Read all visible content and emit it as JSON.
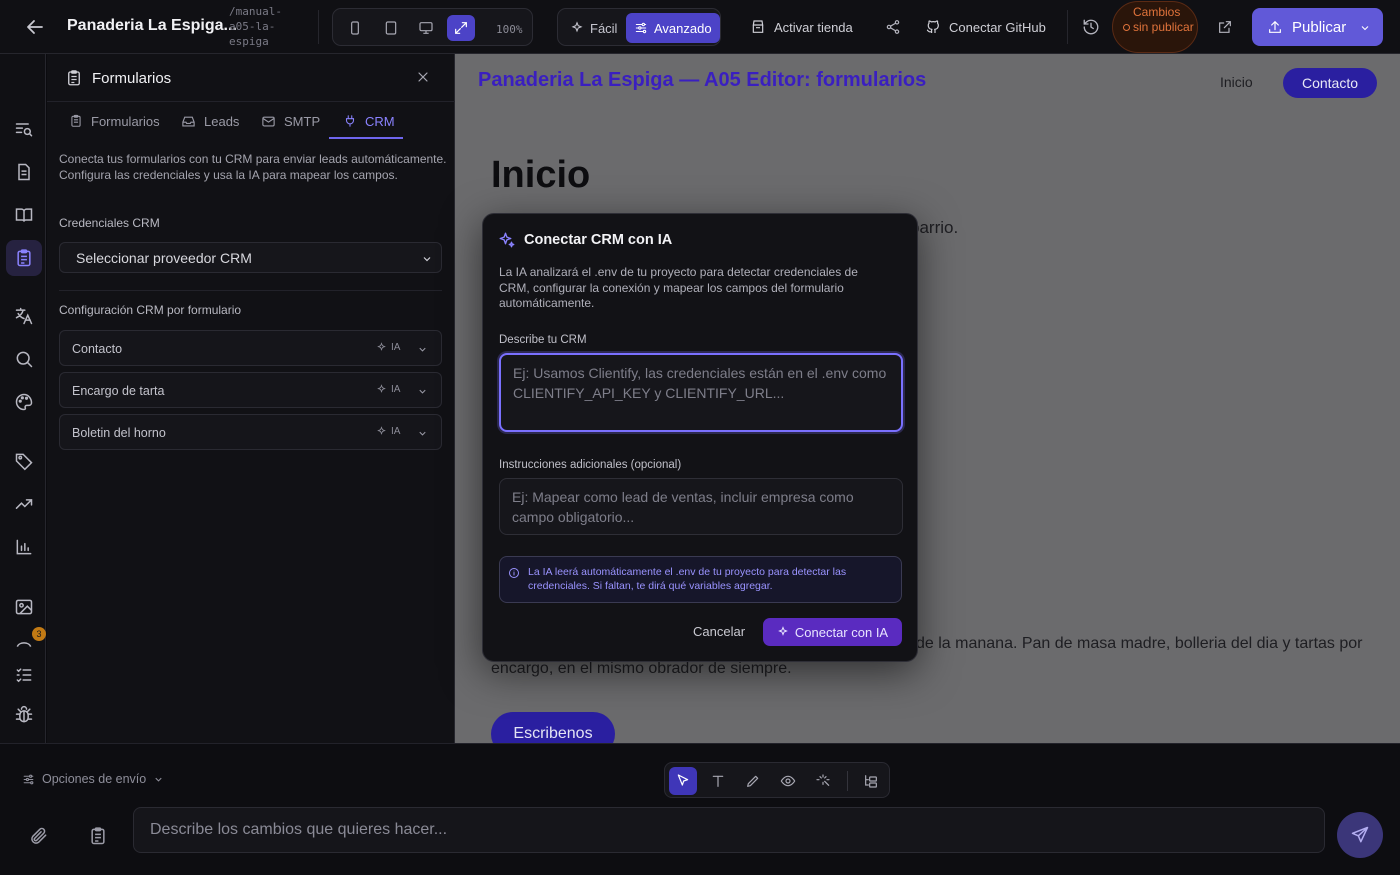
{
  "topbar": {
    "project_title": "Panaderia La Espiga...",
    "project_slug": "/manual-a05-la-espiga",
    "zoom": "100%",
    "mode_easy": "Fácil",
    "mode_advanced": "Avanzado",
    "activate_store": "Activar tienda",
    "connect_github": "Conectar GitHub",
    "unpublished": "Cambios sin publicar",
    "publish": "Publicar"
  },
  "rail": {
    "badge_count": "3"
  },
  "panel": {
    "title": "Formularios",
    "tabs": [
      {
        "label": "Formularios",
        "icon": "clipboard-icon"
      },
      {
        "label": "Leads",
        "icon": "inbox-icon"
      },
      {
        "label": "SMTP",
        "icon": "mail-icon"
      },
      {
        "label": "CRM",
        "icon": "plug-icon"
      }
    ],
    "description": "Conecta tus formularios con tu CRM para enviar leads automáticamente. Configura las credenciales y usa la IA para mapear los campos.",
    "credentials_title": "Credenciales CRM",
    "provider_select": "Seleccionar proveedor CRM",
    "per_form_title": "Configuración CRM por formulario",
    "forms": [
      {
        "name": "Contacto",
        "ia": "IA"
      },
      {
        "name": "Encargo de tarta",
        "ia": "IA"
      },
      {
        "name": "Boletin del horno",
        "ia": "IA"
      }
    ]
  },
  "preview": {
    "site_title": "Panaderia La Espiga — A05 Editor: formularios",
    "nav_home": "Inicio",
    "nav_contact": "Contacto",
    "hero_title": "Inicio",
    "hero_sub_visible": "barrio.",
    "body_visible_right": "de la manana. Pan de masa madre, bolleria del dia y tartas por",
    "body_line2": "encargo, en el mismo obrador de siempre.",
    "cta": "Escribenos"
  },
  "modal": {
    "title": "Conectar CRM con IA",
    "description": "La IA analizará el .env de tu proyecto para detectar credenciales de CRM, configurar la conexión y mapear los campos del formulario automáticamente.",
    "describe_label": "Describe tu CRM",
    "describe_placeholder": "Ej: Usamos Clientify, las credenciales están en el .env como CLIENTIFY_API_KEY y CLIENTIFY_URL...",
    "extra_label": "Instrucciones adicionales (opcional)",
    "extra_placeholder": "Ej: Mapear como lead de ventas, incluir empresa como campo obligatorio...",
    "info": "La IA leerá automáticamente el .env de tu proyecto para detectar las credenciales. Si faltan, te dirá qué variables agregar.",
    "cancel": "Cancelar",
    "connect": "Conectar con IA"
  },
  "bottom": {
    "send_options": "Opciones de envío",
    "prompt_placeholder": "Describe los cambios que quieres hacer..."
  },
  "colors": {
    "accent": "#6159d8",
    "accent_active": "#4c43c7",
    "warning": "#e0733b",
    "connect_button": "#5a2bc0"
  }
}
